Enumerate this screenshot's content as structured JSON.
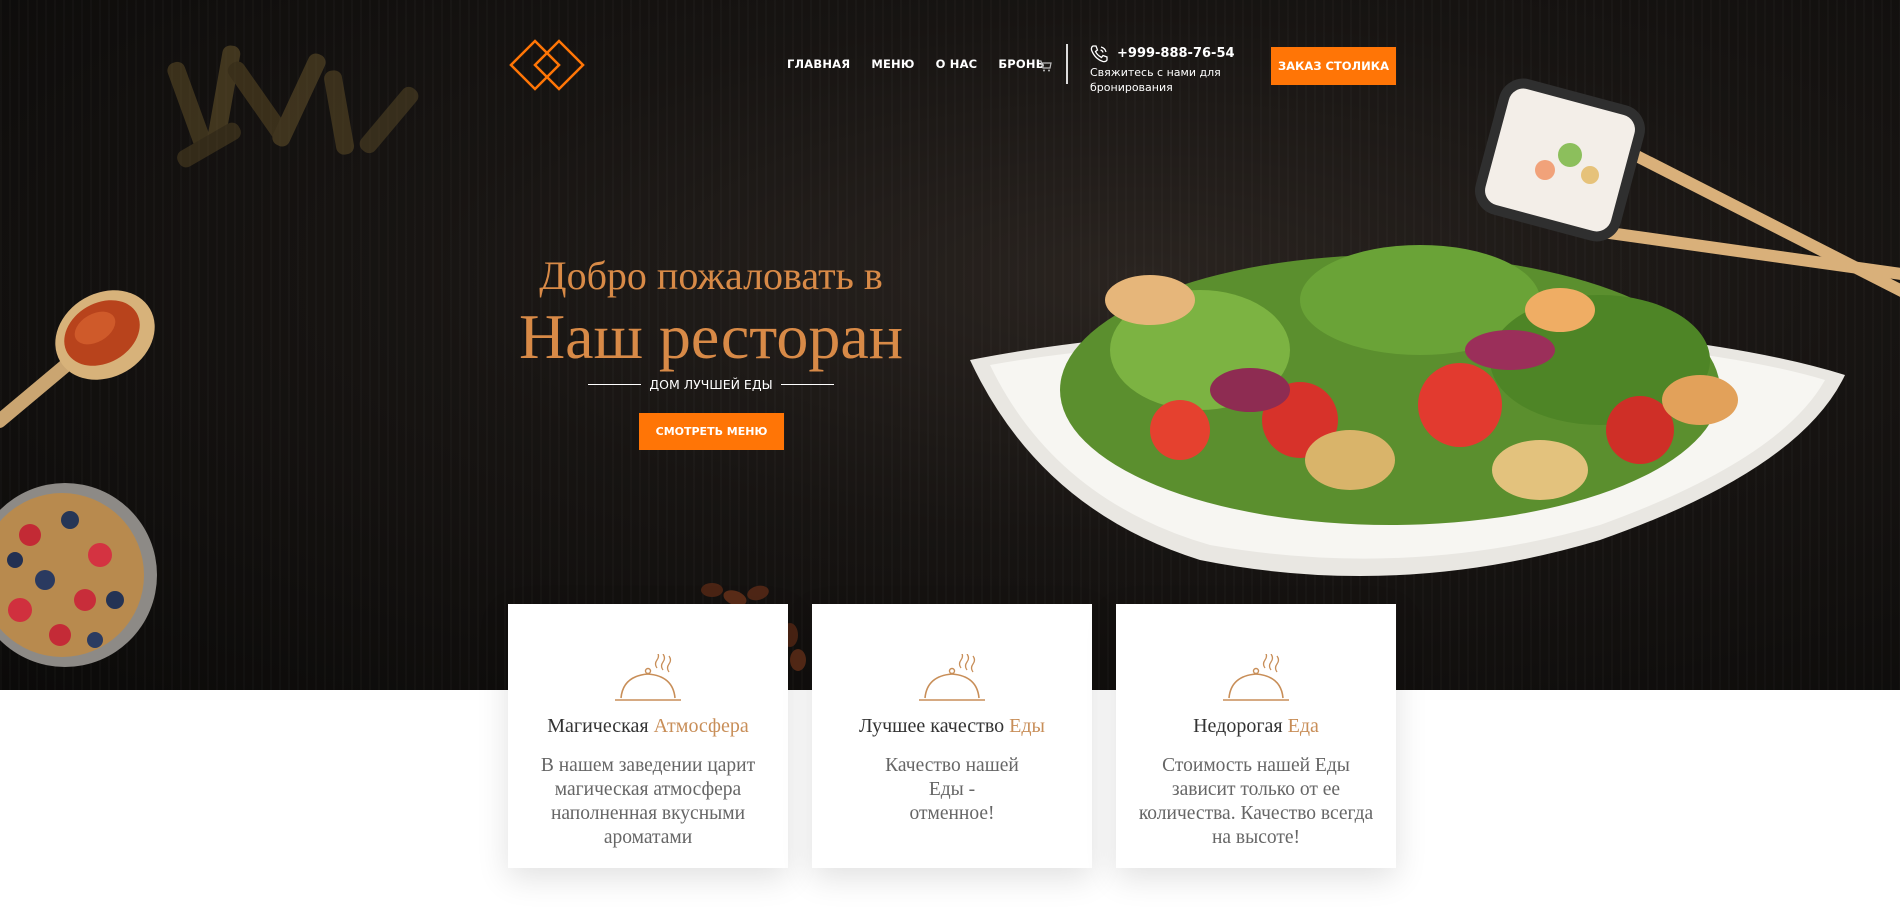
{
  "header": {
    "logo_name": "diamond-logo",
    "nav": [
      {
        "label": "ГЛАВНАЯ"
      },
      {
        "label": "МЕНЮ"
      },
      {
        "label": "О НАС"
      },
      {
        "label": "БРОНЬ"
      }
    ],
    "cart_icon": "cart-icon",
    "phone_icon": "phone-icon",
    "phone": "+999-888-76-54",
    "phone_sub": "Свяжитесь с нами для бронирования",
    "order_button": "ЗАКАЗ СТОЛИКА"
  },
  "hero": {
    "welcome": "Добро пожаловать в",
    "title": "Наш ресторан",
    "subtitle": "ДОМ ЛУЧШЕЙ ЕДЫ",
    "menu_button": "СМОТРЕТЬ МЕНЮ"
  },
  "features": [
    {
      "icon": "cloche-icon",
      "title_plain": "Магическая ",
      "title_accent": "Атмосфера",
      "text": "В нашем заведении царит магическая атмосфера наполненная вкусными ароматами"
    },
    {
      "icon": "cloche-icon",
      "title_plain": "Лучшее качество ",
      "title_accent": "Еды",
      "text": "Качество нашей Еды - отменное!"
    },
    {
      "icon": "cloche-icon",
      "title_plain": "Недорогая ",
      "title_accent": "Еда",
      "text": "Стоимость нашей Еды зависит только от ее количества. Качество всегда на высоте!"
    }
  ],
  "colors": {
    "accent": "#ff7506",
    "heading": "#d88a47",
    "card_accent": "#c88e58",
    "hero_bg": "#171412"
  }
}
